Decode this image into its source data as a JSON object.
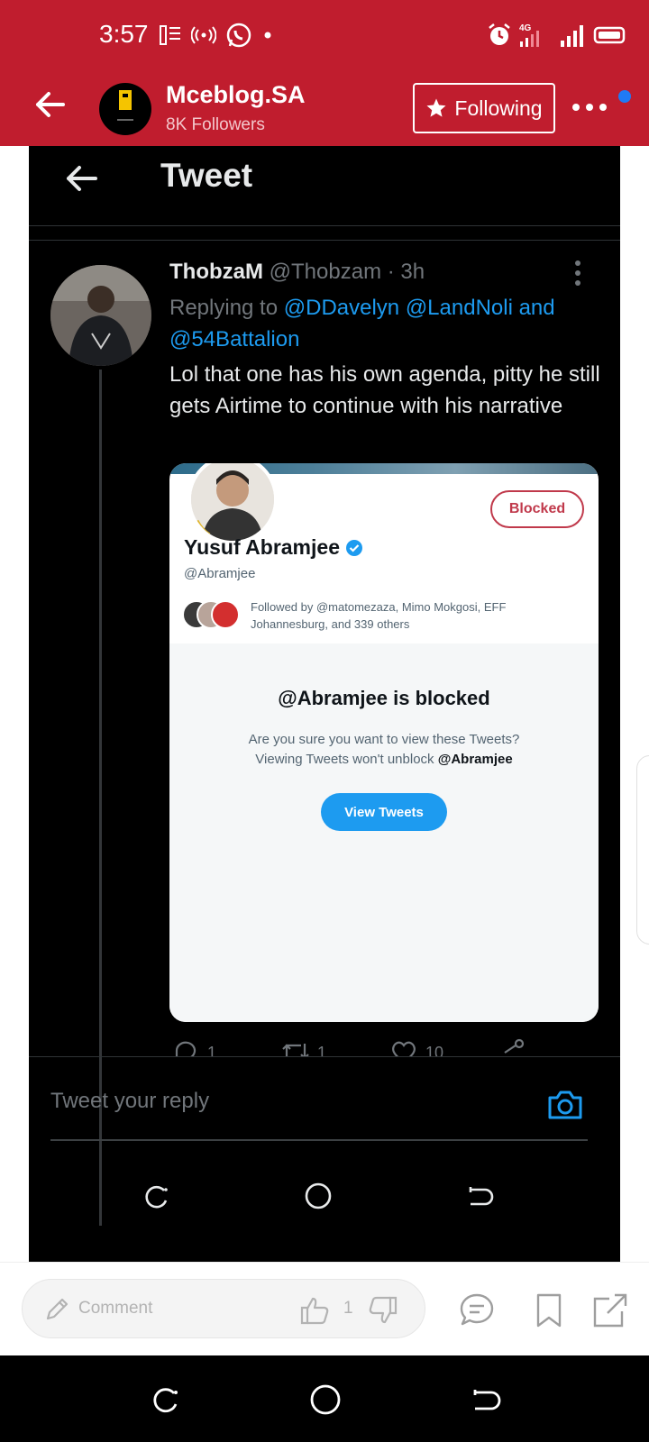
{
  "status_bar": {
    "time": "3:57"
  },
  "header": {
    "blog_name": "Mceblog.SA",
    "followers": "8K Followers",
    "follow_label": "Following"
  },
  "tweet_view": {
    "title": "Tweet",
    "author": {
      "name": "ThobzaM",
      "handle": "@Thobzam",
      "time": "· 3h"
    },
    "replying_prefix": "Replying to",
    "reply_mentions_1": "@DDavelyn @LandNoli and",
    "reply_mentions_2": "@54Battalion",
    "text": "Lol that one has his own agenda, pitty he still gets Airtime to continue with his narrative",
    "card": {
      "badge": "Blocked",
      "name": "Yusuf Abramjee",
      "handle": "@Abramjee",
      "followed_by": "Followed by @matomezaza, Mimo Mokgosi, EFF Johannesburg, and 339 others",
      "blocked_title": "@Abramjee is blocked",
      "blocked_line1": "Are you sure you want to view these Tweets?",
      "blocked_line2_prefix": "Viewing Tweets won't unblock",
      "blocked_line2_handle": "@Abramjee",
      "view_button": "View Tweets"
    },
    "actions": {
      "replies": "1",
      "retweets": "1",
      "likes": "10"
    },
    "reply_placeholder": "Tweet your reply"
  },
  "bottom_bar": {
    "comment_placeholder": "Comment",
    "like_count": "1"
  },
  "colors": {
    "brand_red": "#c01d2e",
    "twitter_blue": "#1d9bf0",
    "blocked_red": "#c0394b",
    "notify_dot": "#1f7af5"
  }
}
